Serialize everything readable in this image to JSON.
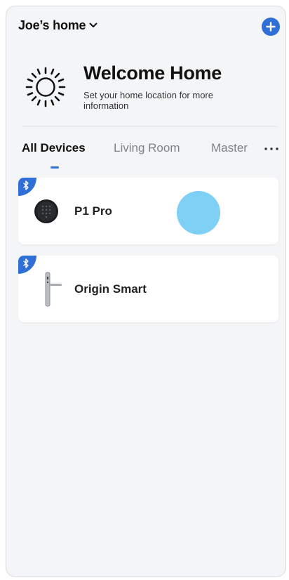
{
  "header": {
    "home_name": "Joe’s home",
    "add_icon": "plus-circle-icon",
    "accent_color": "#2f6fd6"
  },
  "welcome": {
    "title": "Welcome Home",
    "subtitle": "Set your home location for more information",
    "icon": "sun-icon",
    "chevron": "›"
  },
  "tabs": [
    {
      "label": "All Devices",
      "active": true
    },
    {
      "label": "Living Room",
      "active": false
    },
    {
      "label": "Master",
      "active": false
    }
  ],
  "devices": [
    {
      "name": "P1 Pro",
      "icon": "keypad-lock-icon",
      "connection_icon": "bluetooth-icon"
    },
    {
      "name": "Origin Smart",
      "icon": "lever-handle-icon",
      "connection_icon": "bluetooth-icon"
    }
  ]
}
